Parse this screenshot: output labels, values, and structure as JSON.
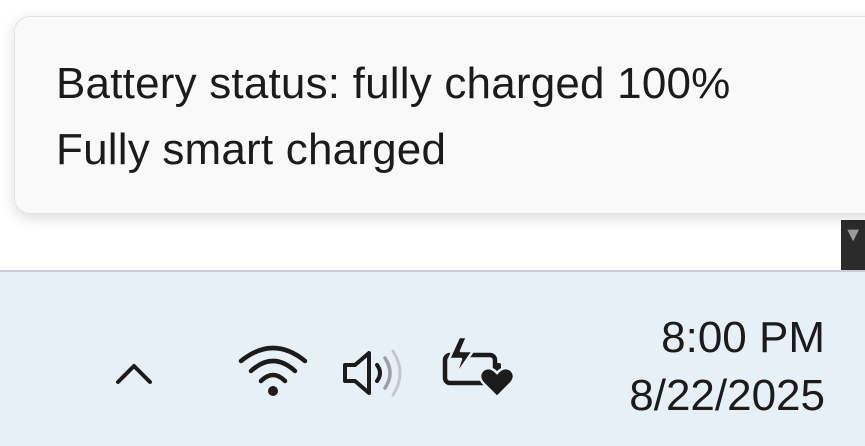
{
  "tooltip": {
    "line1": "Battery status: fully charged 100%",
    "line2": "Fully smart charged"
  },
  "taskbar": {
    "tray_icons": [
      {
        "name": "show-hidden-icons-chevron"
      },
      {
        "name": "wifi-icon"
      },
      {
        "name": "volume-icon"
      },
      {
        "name": "battery-smart-charging-icon"
      }
    ],
    "time": "8:00 PM",
    "date": "8/22/2025"
  },
  "colors": {
    "taskbar_bg": "#e8f0f7",
    "tooltip_bg": "#f9f9f9",
    "text": "#1b1b1b"
  }
}
